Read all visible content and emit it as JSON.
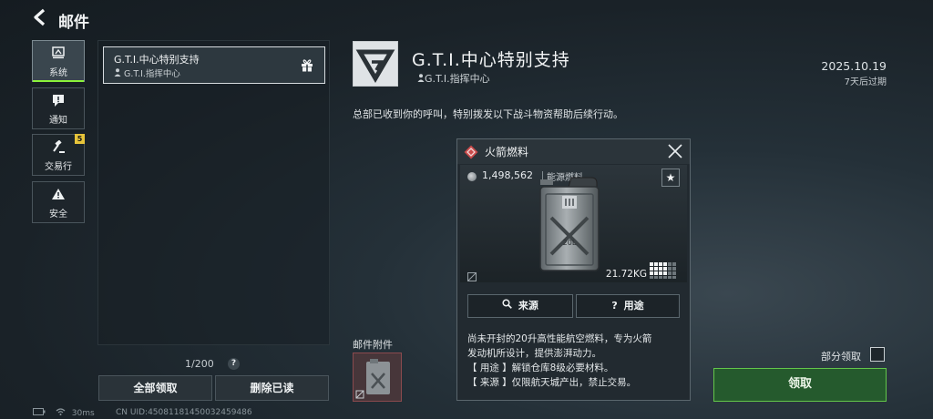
{
  "header": {
    "back_icon": "back-arrow-icon",
    "title": "邮件"
  },
  "categories": [
    {
      "label": "系统",
      "icon": "system-icon",
      "active": true
    },
    {
      "label": "通知",
      "icon": "notice-icon",
      "active": false
    },
    {
      "label": "交易行",
      "icon": "hammer-icon",
      "active": false,
      "badge": "5"
    },
    {
      "label": "安全",
      "icon": "warning-icon",
      "active": false
    }
  ],
  "mail_list": {
    "items": [
      {
        "title": "G.T.I.中心特别支持",
        "sender": "G.T.I.指挥中心",
        "icon": "gift-icon"
      }
    ],
    "count": "1/200",
    "help_label": "?",
    "claim_all_label": "全部领取",
    "delete_read_label": "删除已读"
  },
  "status_bar": {
    "ping": "30ms",
    "uid": "CN UID:4508118145003245948​6"
  },
  "detail": {
    "title": "G.T.I.中心特别支持",
    "sender": "G.T.I.指挥中心",
    "date": "2025.10.19",
    "expire": "7天后过期",
    "body": "总部已收到你的呼叫，特别拨发以下战斗物资帮助后续行动。",
    "attachments_label": "邮件附件",
    "partial_claim_label": "部分领取",
    "claim_label": "领取"
  },
  "popup": {
    "title": "火箭燃料",
    "price": "1,498,562",
    "category": "能源燃料",
    "favorite_icon": "star-icon",
    "canister_label": "20L",
    "weight": "21.72KG",
    "source_label": "来源",
    "usage_label": "用途",
    "description": [
      "尚未开封的20升高性能航空燃料，专为火箭",
      "发动机所设计，提供澎湃动力。",
      "【 用途 】解锁仓库8级必要材料。",
      "【 来源 】仅限航天城产出，禁止交易。"
    ]
  },
  "colors": {
    "accent_green": "#63c64a",
    "active_tab_bar": "#8bf23a",
    "badge": "#e7c43a",
    "rarity_red": "#c94a4a"
  }
}
